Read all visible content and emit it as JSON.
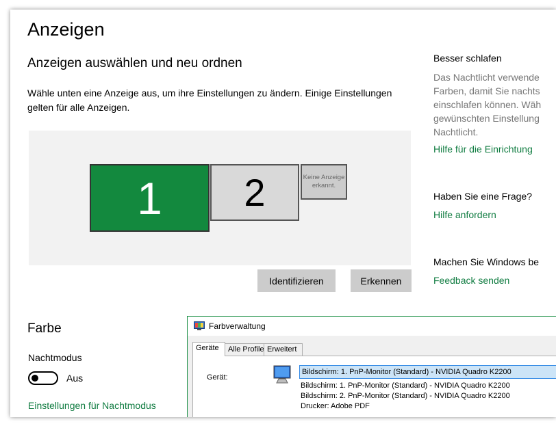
{
  "page": {
    "title": "Anzeigen",
    "heading": "Anzeigen auswählen und neu ordnen",
    "description": "Wähle unten eine Anzeige aus, um ihre Einstellungen zu ändern. Einige Einstellungen gelten für alle Anzeigen."
  },
  "displays": [
    {
      "label": "1",
      "selected": true
    },
    {
      "label": "2",
      "selected": false
    },
    {
      "label": "Keine Anzeige erkannt.",
      "selected": false
    }
  ],
  "buttons": {
    "identify": "Identifizieren",
    "detect": "Erkennen"
  },
  "sidebar": {
    "section1_title": "Besser schlafen",
    "section1_lines": [
      "Das Nachtlicht verwende",
      "Farben, damit Sie nachts",
      "einschlafen können. Wäh",
      "gewünschten Einstellung",
      "Nachtlicht."
    ],
    "section1_link": "Hilfe für die Einrichtung",
    "section2_title": "Haben Sie eine Frage?",
    "section2_link": "Hilfe anfordern",
    "section3_title": "Machen Sie Windows be",
    "section3_link": "Feedback senden"
  },
  "color": {
    "heading": "Farbe",
    "night_mode_label": "Nachtmodus",
    "night_mode_state": "Aus",
    "night_mode_link": "Einstellungen für Nachtmodus"
  },
  "dialog": {
    "title": "Farbverwaltung",
    "tabs": [
      "Geräte",
      "Alle Profile",
      "Erweitert"
    ],
    "device_label": "Gerät:",
    "selected_device": "Bildschirm: 1. PnP-Monitor (Standard) - NVIDIA Quadro K2200",
    "options": [
      "Bildschirm: 1. PnP-Monitor (Standard) - NVIDIA Quadro K2200",
      "Bildschirm: 2. PnP-Monitor (Standard) - NVIDIA Quadro K2200",
      "Drucker: Adobe PDF"
    ]
  },
  "colors": {
    "accent": "#107c41",
    "selected_display": "#13893e"
  }
}
